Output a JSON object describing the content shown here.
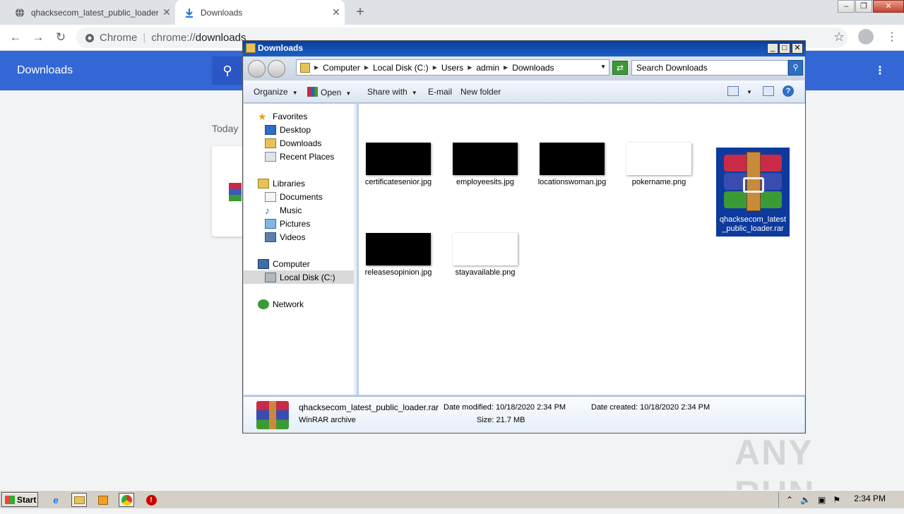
{
  "browser": {
    "tabs": [
      {
        "label": "qhacksecom_latest_public_loader",
        "active": false
      },
      {
        "label": "Downloads",
        "active": true
      }
    ],
    "omnibox": {
      "site": "Chrome",
      "url_prefix": "chrome://",
      "url_path": "downloads"
    }
  },
  "downloads_page": {
    "title": "Downloads",
    "section": "Today"
  },
  "explorer": {
    "title": "Downloads",
    "breadcrumbs": [
      "Computer",
      "Local Disk (C:)",
      "Users",
      "admin",
      "Downloads"
    ],
    "search_placeholder": "Search Downloads",
    "commands": {
      "organize": "Organize",
      "open": "Open",
      "share_with": "Share with",
      "email": "E-mail",
      "new_folder": "New folder"
    },
    "nav": {
      "favorites": "Favorites",
      "desktop": "Desktop",
      "downloads": "Downloads",
      "recent_places": "Recent Places",
      "libraries": "Libraries",
      "documents": "Documents",
      "music": "Music",
      "pictures": "Pictures",
      "videos": "Videos",
      "computer": "Computer",
      "local_disk": "Local Disk (C:)",
      "network": "Network"
    },
    "files": [
      {
        "name": "certificatesenior.jpg",
        "kind": "dark"
      },
      {
        "name": "employeesits.jpg",
        "kind": "dark"
      },
      {
        "name": "locationswoman.jpg",
        "kind": "dark"
      },
      {
        "name": "pokername.png",
        "kind": "light"
      },
      {
        "name": "qhacksecom_latest_public_loader.rar",
        "kind": "rar",
        "selected": true
      },
      {
        "name": "releasesopinion.jpg",
        "kind": "dark"
      },
      {
        "name": "stayavailable.png",
        "kind": "light"
      }
    ],
    "details": {
      "name": "qhacksecom_latest_public_loader.rar",
      "type": "WinRAR archive",
      "date_modified_label": "Date modified:",
      "date_modified": "10/18/2020 2:34 PM",
      "size_label": "Size:",
      "size": "21.7 MB",
      "date_created_label": "Date created:",
      "date_created": "10/18/2020 2:34 PM"
    }
  },
  "taskbar": {
    "start": "Start",
    "clock": "2:34 PM"
  },
  "watermark": "ANY RUN",
  "colors": {
    "chrome_header": "#3367d6",
    "selection": "#0d3a9c"
  }
}
